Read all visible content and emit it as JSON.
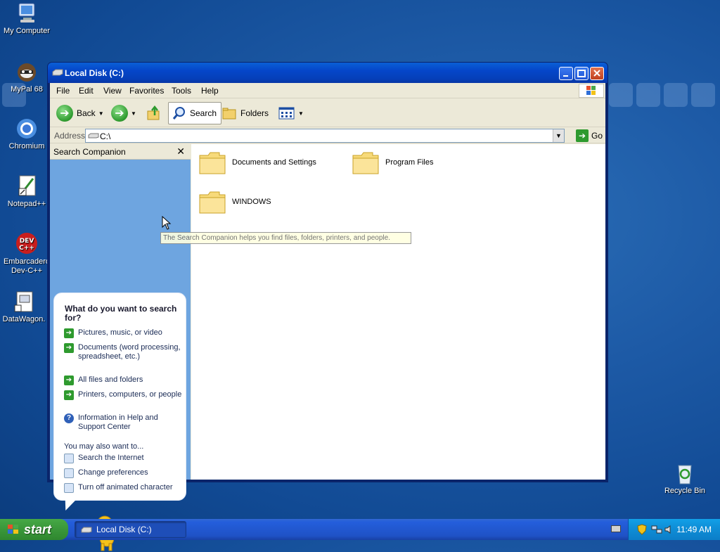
{
  "desktop": {
    "icons": [
      {
        "label": "My Computer"
      },
      {
        "label": "MyPal 68"
      },
      {
        "label": "Chromium"
      },
      {
        "label": "Notepad++"
      },
      {
        "label": "Embarcadero Dev-C++"
      },
      {
        "label": "DataWagon."
      },
      {
        "label": "Recycle Bin"
      }
    ]
  },
  "window": {
    "title": "Local Disk (C:)",
    "menu": [
      "File",
      "Edit",
      "View",
      "Favorites",
      "Tools",
      "Help"
    ],
    "toolbar": {
      "back": "Back",
      "search": "Search",
      "folders": "Folders"
    },
    "address": {
      "label": "Address",
      "value": "C:\\",
      "go": "Go"
    },
    "search_companion": {
      "title": "Search Companion",
      "question": "What do you want to search for?",
      "options": [
        "Pictures, music, or video",
        "Documents (word processing, spreadsheet, etc.)",
        "All files and folders",
        "Printers, computers, or people",
        "Information in Help and Support Center"
      ],
      "also_label": "You may also want to...",
      "also_options": [
        "Search the Internet",
        "Change preferences",
        "Turn off animated character"
      ]
    },
    "folders": [
      "Documents and Settings",
      "Program Files",
      "WINDOWS"
    ],
    "tooltip": "The Search Companion helps you find files, folders, printers, and people."
  },
  "taskbar": {
    "start": "start",
    "task": "Local Disk (C:)",
    "clock": "11:49 AM"
  },
  "colors": {
    "titlebar": "#0546c9",
    "pane": "#6ea5e0",
    "start_button": "#3c9a3c",
    "tray": "#0f8fd8"
  }
}
